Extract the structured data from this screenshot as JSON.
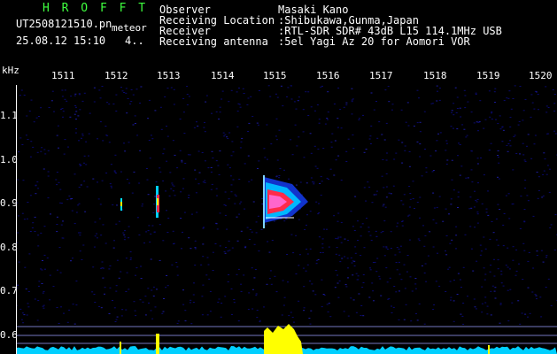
{
  "header": {
    "brand": "H R O F F T",
    "filename": "UT2508121510.pn",
    "meteor_label": "meteor",
    "timestamp": "25.08.12 15:10",
    "count": "4..",
    "info": [
      {
        "label": "Observer",
        "value": "Masaki Kano"
      },
      {
        "label": "Receiving Location",
        "value": ":Shibukawa,Gunma,Japan"
      },
      {
        "label": "Receiver",
        "value": ":RTL-SDR SDR# 43dB L15 114.1MHz USB"
      },
      {
        "label": "Receiving antenna",
        "value": ":5el Yagi Az 20 for Aomori VOR"
      }
    ]
  },
  "axes": {
    "y_unit": "kHz",
    "x_ticks": [
      "1511",
      "1512",
      "1513",
      "1514",
      "1515",
      "1516",
      "1517",
      "1518",
      "1519",
      "1520"
    ],
    "y_ticks": [
      "1.1",
      "1.0",
      "0.9",
      "0.8",
      "0.7",
      "0.6"
    ]
  },
  "colors": {
    "background": "#000000",
    "noise": "#0a0a6e",
    "echo_cyan": "#00e5ff",
    "echo_red": "#ff2a4a",
    "signal_yellow": "#ffff00",
    "baseline_cyan": "#00cfff",
    "brand_green": "#3fff3f"
  }
}
